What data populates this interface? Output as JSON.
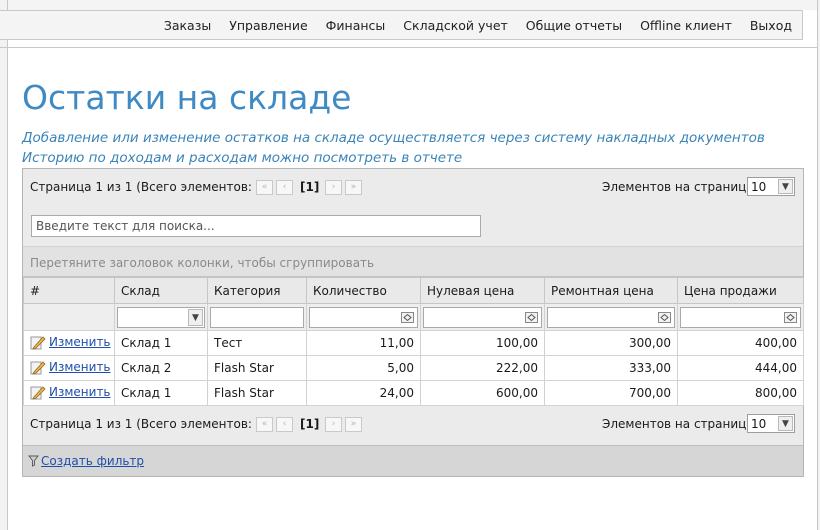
{
  "nav": {
    "items": [
      "Заказы",
      "Управление",
      "Финансы",
      "Складской учет",
      "Общие отчеты",
      "Offline клиент",
      "Выход"
    ]
  },
  "page": {
    "title": "Остатки на складе",
    "description": "Добавление или изменение остатков на складе осуществляется через систему накладных документов Историю по доходам и расходам можно посмотреть в отчете"
  },
  "pager": {
    "info": "Страница 1 из 1 (Всего элементов: 3)",
    "current_page": "[1]",
    "items_per_page_label": "Элементов на странице:",
    "items_per_page": "10"
  },
  "search": {
    "placeholder": "Введите текст для поиска..."
  },
  "group_hint": "Перетяните заголовок колонки, чтобы сгруппировать",
  "table": {
    "columns": [
      "#",
      "Склад",
      "Категория",
      "Количество",
      "Нулевая цена",
      "Ремонтная цена",
      "Цена продажи"
    ],
    "rows": [
      {
        "action": "Изменить",
        "warehouse": "Склад 1",
        "category": "Тест",
        "quantity": "11,00",
        "zero_price": "100,00",
        "repair_price": "300,00",
        "sale_price": "400,00"
      },
      {
        "action": "Изменить",
        "warehouse": "Склад 2",
        "category": "Flash Star",
        "quantity": "5,00",
        "zero_price": "222,00",
        "repair_price": "333,00",
        "sale_price": "444,00"
      },
      {
        "action": "Изменить",
        "warehouse": "Склад 1",
        "category": "Flash Star",
        "quantity": "24,00",
        "zero_price": "600,00",
        "repair_price": "700,00",
        "sale_price": "800,00"
      }
    ]
  },
  "footer": {
    "create_filter": "Создать фильтр"
  },
  "colors": {
    "title": "#3e8ac4",
    "link": "#1f4fa8",
    "description": "#3a84b8"
  }
}
